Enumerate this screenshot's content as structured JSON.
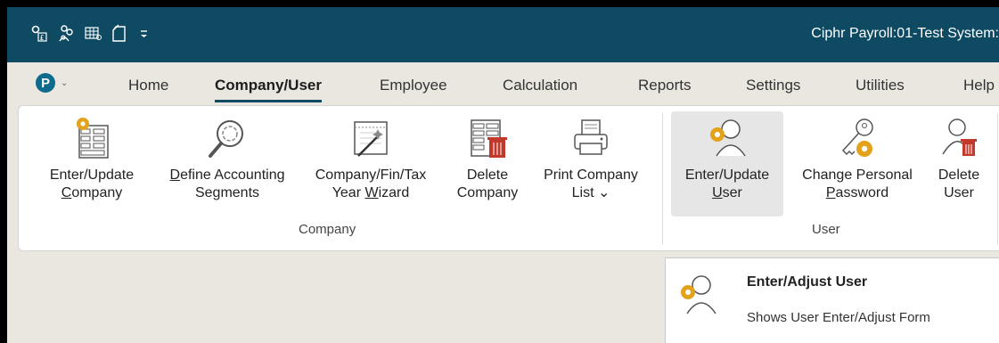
{
  "title_bar": {
    "title": "Ciphr Payroll:01-Test System:",
    "qat_icons": [
      "payroll-settings-icon",
      "users-icon",
      "grid-icon",
      "new-document-icon",
      "customize-arrow-icon"
    ]
  },
  "app_menu": {
    "logo_letter": "P",
    "chevron": "⌄"
  },
  "tabs": [
    {
      "label": "Home",
      "active": false
    },
    {
      "label": "Company/User",
      "active": true
    },
    {
      "label": "Employee",
      "active": false
    },
    {
      "label": "Calculation",
      "active": false
    },
    {
      "label": "Reports",
      "active": false
    },
    {
      "label": "Settings",
      "active": false
    },
    {
      "label": "Utilities",
      "active": false
    },
    {
      "label": "Help",
      "active": false
    }
  ],
  "ribbon": {
    "company_group": {
      "label": "Company",
      "buttons": [
        {
          "line1": "Enter/Update",
          "line2_pre": "",
          "line2_u": "C",
          "line2_post": "ompany",
          "icon": "gear-table-icon"
        },
        {
          "line1_pre": "",
          "line1_u": "D",
          "line1_post": "efine Accounting",
          "line2": "Segments",
          "icon": "magnifier-icon"
        },
        {
          "line1": "Company/Fin/Tax",
          "line2_pre": "Year ",
          "line2_u": "W",
          "line2_post": "izard",
          "icon": "wizard-icon"
        },
        {
          "line1": "Delete",
          "line2": "Company",
          "icon": "delete-table-icon"
        },
        {
          "line1": "Print Company",
          "line2": "List",
          "line2_suffix": "⌄",
          "icon": "printer-icon"
        }
      ]
    },
    "user_group": {
      "label": "User",
      "buttons": [
        {
          "line1": "Enter/Update",
          "line2_pre": "",
          "line2_u": "U",
          "line2_post": "ser",
          "icon": "gear-user-icon",
          "selected": true
        },
        {
          "line1": "Change Personal",
          "line2_pre": "",
          "line2_u": "P",
          "line2_post": "assword",
          "icon": "key-gear-icon"
        },
        {
          "line1": "Delete",
          "line2": "User",
          "icon": "delete-user-icon"
        }
      ]
    }
  },
  "tooltip": {
    "title": "Enter/Adjust User",
    "description": "Shows User Enter/Adjust Form",
    "icon": "gear-user-icon"
  },
  "colors": {
    "title_bar": "#0f4a63",
    "background": "#eae7e0",
    "accent_gear": "#e3a21a",
    "delete_red": "#c0392b"
  }
}
